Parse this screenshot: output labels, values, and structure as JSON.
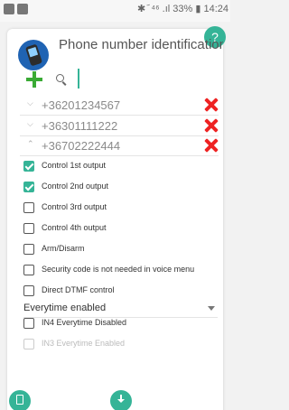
{
  "statusbar": {
    "right_text": "✱ ᷄ ⁴⁶ .ıl 33% ▮ 14:24"
  },
  "header": {
    "title": "Phone number identification",
    "help_label": "?"
  },
  "search": {
    "value": "",
    "placeholder": ""
  },
  "phones": [
    {
      "number": "+36201234567",
      "chevron": "⌵"
    },
    {
      "number": "+36301111222",
      "chevron": "⌵"
    },
    {
      "number": "+36702222444",
      "chevron": "⌃"
    }
  ],
  "options": [
    {
      "label": "Control 1st output",
      "checked": true
    },
    {
      "label": "Control 2nd output",
      "checked": true
    },
    {
      "label": "Control 3rd output",
      "checked": false
    },
    {
      "label": "Control 4th output",
      "checked": false
    },
    {
      "label": "Arm/Disarm",
      "checked": false
    },
    {
      "label": "Security code is not needed in voice menu",
      "checked": false
    },
    {
      "label": "Direct DTMF control",
      "checked": false
    }
  ],
  "dropdown": {
    "value": "Everytime enabled"
  },
  "input_options": [
    {
      "label": "IN4 Everytime Disabled",
      "checked": false,
      "disabled": false
    },
    {
      "label": "IN3 Everytime Enabled",
      "checked": false,
      "disabled": true
    }
  ],
  "colors": {
    "accent": "#35b497",
    "add": "#3aaa35",
    "delete": "#ee2222"
  },
  "icons": {
    "app": "phone-icon",
    "add": "plus-icon",
    "search": "search-icon",
    "delete": "close-icon",
    "fab_left": "document-icon",
    "fab_center": "download-icon"
  }
}
